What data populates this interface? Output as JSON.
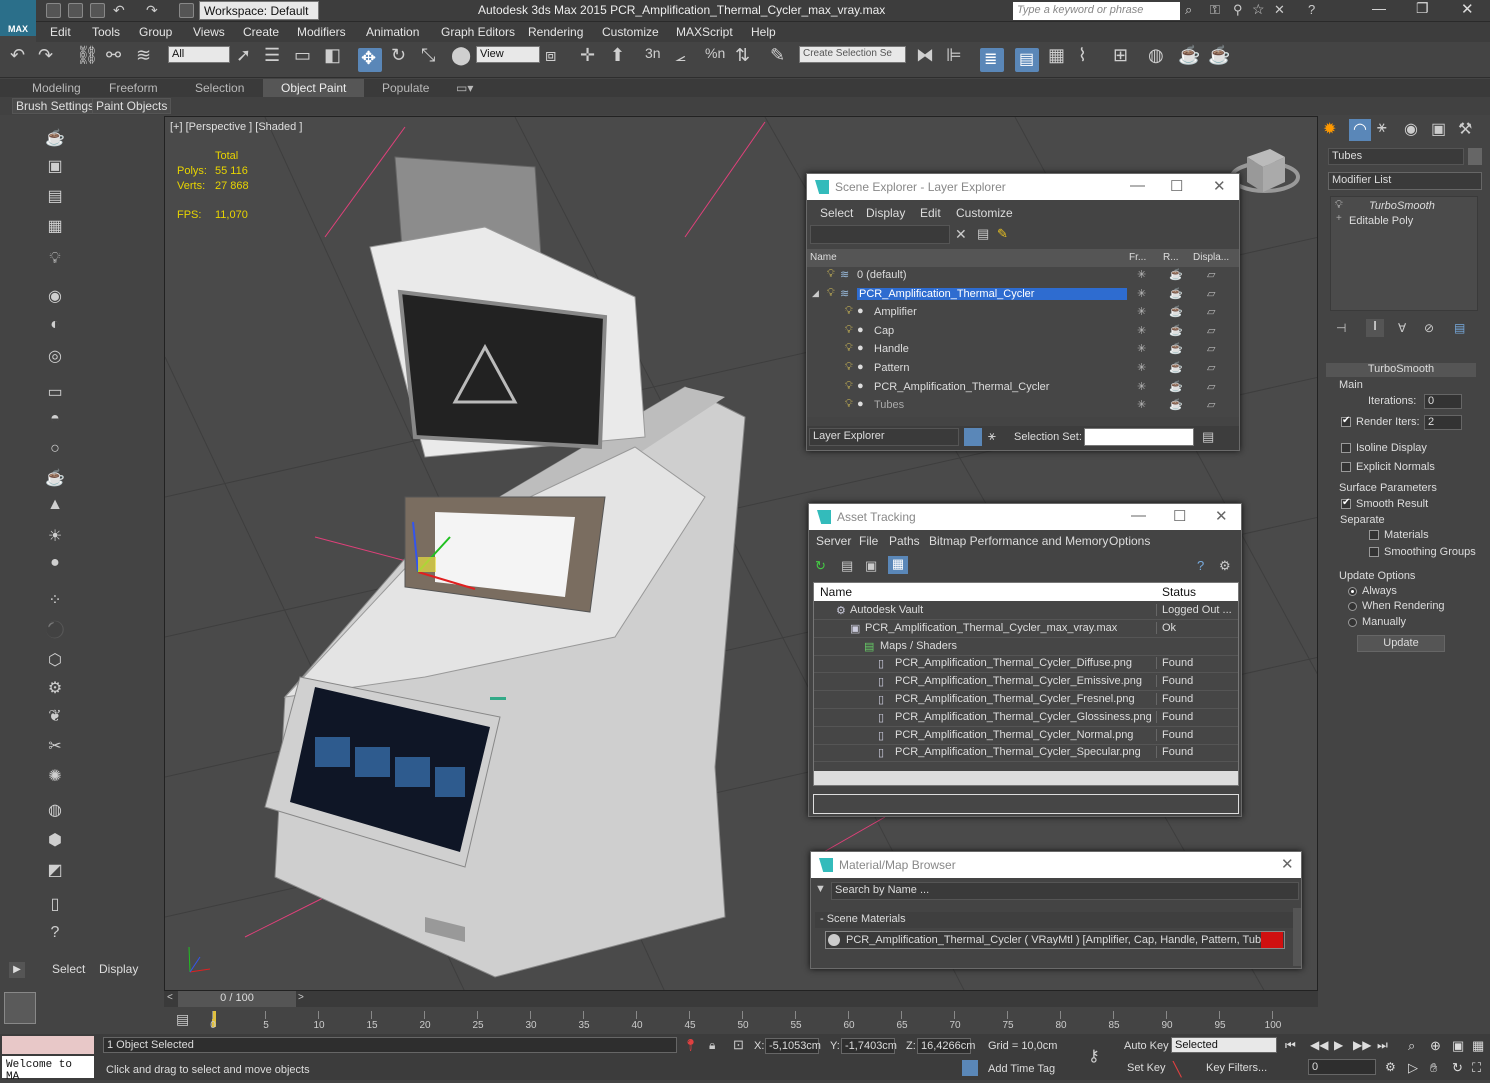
{
  "app": {
    "title": "Autodesk 3ds Max  2015    PCR_Amplification_Thermal_Cycler_max_vray.max",
    "logo": "MAX",
    "workspace": "Workspace: Default",
    "search_placeholder": "Type a keyword or phrase"
  },
  "menu": [
    "Edit",
    "Tools",
    "Group",
    "Views",
    "Create",
    "Modifiers",
    "Animation",
    "Graph Editors",
    "Rendering",
    "Customize",
    "MAXScript",
    "Help"
  ],
  "toolbar": {
    "selection_filter": "All",
    "ref_coord": "View",
    "create_selection_set": "Create Selection Se",
    "snap_labels": [
      "3",
      "n",
      "%",
      "n"
    ]
  },
  "ribbon": {
    "tabs": [
      "Modeling",
      "Freeform",
      "Selection",
      "Object Paint",
      "Populate"
    ],
    "active_tab": "Object Paint",
    "subtabs": [
      "Brush Settings",
      "Paint Objects"
    ]
  },
  "viewport": {
    "label": "[+] [Perspective ] [Shaded ]",
    "stats_total": "Total",
    "stats_polys_label": "Polys:",
    "stats_polys": "55 116",
    "stats_verts_label": "Verts:",
    "stats_verts": "27 868",
    "stats_fps_label": "FPS:",
    "stats_fps": "11,070"
  },
  "scene_explorer": {
    "title": "Scene Explorer - Layer Explorer",
    "menu": [
      "Select",
      "Display",
      "Edit",
      "Customize"
    ],
    "columns": [
      "Name",
      "Fr...",
      "R...",
      "Displa..."
    ],
    "rows": [
      {
        "name": "0 (default)",
        "level": 0
      },
      {
        "name": "PCR_Amplification_Thermal_Cycler",
        "level": 0,
        "selected": true
      },
      {
        "name": "Amplifier",
        "level": 1
      },
      {
        "name": "Cap",
        "level": 1
      },
      {
        "name": "Handle",
        "level": 1
      },
      {
        "name": "Pattern",
        "level": 1
      },
      {
        "name": "PCR_Amplification_Thermal_Cycler",
        "level": 1
      },
      {
        "name": "Tubes",
        "level": 1
      }
    ],
    "footer_explorer": "Layer Explorer",
    "footer_selset_label": "Selection Set:"
  },
  "asset_tracking": {
    "title": "Asset Tracking",
    "menu": [
      "Server",
      "File",
      "Paths",
      "Bitmap Performance and Memory",
      "Options"
    ],
    "columns": [
      "Name",
      "Status"
    ],
    "rows": [
      {
        "name": "Autodesk Vault",
        "status": "Logged Out ...",
        "level": 0
      },
      {
        "name": "PCR_Amplification_Thermal_Cycler_max_vray.max",
        "status": "Ok",
        "level": 1
      },
      {
        "name": "Maps / Shaders",
        "status": "",
        "level": 2
      },
      {
        "name": "PCR_Amplification_Thermal_Cycler_Diffuse.png",
        "status": "Found",
        "level": 3
      },
      {
        "name": "PCR_Amplification_Thermal_Cycler_Emissive.png",
        "status": "Found",
        "level": 3
      },
      {
        "name": "PCR_Amplification_Thermal_Cycler_Fresnel.png",
        "status": "Found",
        "level": 3
      },
      {
        "name": "PCR_Amplification_Thermal_Cycler_Glossiness.png",
        "status": "Found",
        "level": 3
      },
      {
        "name": "PCR_Amplification_Thermal_Cycler_Normal.png",
        "status": "Found",
        "level": 3
      },
      {
        "name": "PCR_Amplification_Thermal_Cycler_Specular.png",
        "status": "Found",
        "level": 3
      }
    ]
  },
  "material_browser": {
    "title": "Material/Map Browser",
    "search_placeholder": "Search by Name ...",
    "section": "- Scene Materials",
    "material": "PCR_Amplification_Thermal_Cycler  ( VRayMtl )  [Amplifier, Cap, Handle, Pattern, Tubes]",
    "swatch_color": "#d01010"
  },
  "command_panel": {
    "object_name": "Tubes",
    "modifier_list": "Modifier List",
    "stack": [
      "TurboSmooth",
      "Editable Poly"
    ],
    "rollout_title": "TurboSmooth",
    "main_label": "Main",
    "iterations_label": "Iterations:",
    "iterations": "0",
    "render_iters_label": "Render Iters:",
    "render_iters": "2",
    "isoline": "Isoline Display",
    "explicit_normals": "Explicit Normals",
    "surface_params": "Surface Parameters",
    "smooth_result": "Smooth Result",
    "separate": "Separate",
    "materials": "Materials",
    "smoothing_groups": "Smoothing Groups",
    "update_options": "Update Options",
    "always": "Always",
    "when_rendering": "When Rendering",
    "manually": "Manually",
    "update_button": "Update"
  },
  "left_panel": {
    "select": "Select",
    "display": "Display"
  },
  "timeline": {
    "frame": "0 / 100",
    "ticks": [
      "0",
      "5",
      "10",
      "15",
      "20",
      "25",
      "30",
      "35",
      "40",
      "45",
      "50",
      "55",
      "60",
      "65",
      "70",
      "75",
      "80",
      "85",
      "90",
      "95",
      "100"
    ]
  },
  "status": {
    "maxscript": "Welcome to MA",
    "selected": "1 Object Selected",
    "prompt": "Click and drag to select and move objects",
    "x_label": "X:",
    "x": "-5,1053cm",
    "y_label": "Y:",
    "y": "-1,7403cm",
    "z_label": "Z:",
    "z": "16,4266cm",
    "grid": "Grid = 10,0cm",
    "add_time_tag": "Add Time Tag",
    "auto_key": "Auto Key",
    "set_key": "Set Key",
    "key_mode": "Selected",
    "key_filters": "Key Filters...",
    "frame_field": "0"
  }
}
